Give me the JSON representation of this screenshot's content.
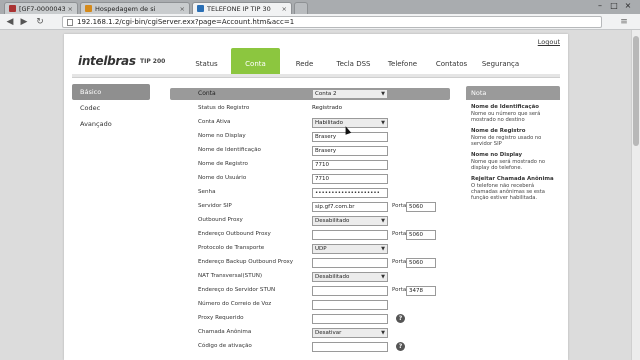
{
  "browser": {
    "tabs": [
      {
        "label": "[GF7-0000043807] R",
        "color": "#a33"
      },
      {
        "label": "Hospedagem de si",
        "color": "#d58a1a"
      },
      {
        "label": "TELEFONE IP TIP 30",
        "color": "#2a6fb5"
      }
    ],
    "close_glyph": "×",
    "url": "192.168.1.2/cgi-bin/cgiServer.exx?page=Account.htm&acc=1",
    "window_controls": [
      "–",
      "□",
      "×"
    ]
  },
  "header": {
    "logout": "Logout",
    "logo": "intelbras",
    "model": "TIP 200"
  },
  "nav": {
    "items": [
      "Status",
      "Conta",
      "Rede",
      "Tecla DSS",
      "Telefone",
      "Contatos",
      "Segurança"
    ],
    "active_index": 1
  },
  "sidebar": {
    "items": [
      "Básico",
      "Codec",
      "Avançado"
    ],
    "active_index": 0
  },
  "form": {
    "conta": {
      "label": "Conta",
      "value": "Conta 2"
    },
    "status_registro": {
      "label": "Status do Registro",
      "value": "Registrado"
    },
    "conta_ativa": {
      "label": "Conta Ativa",
      "value": "Habilitado"
    },
    "nome_display": {
      "label": "Nome no Display",
      "value": "Brasery"
    },
    "nome_identificacao": {
      "label": "Nome de Identificação",
      "value": "Brasery"
    },
    "nome_registro": {
      "label": "Nome de Registro",
      "value": "7710"
    },
    "nome_usuario": {
      "label": "Nome do Usuário",
      "value": "7710"
    },
    "senha": {
      "label": "Senha",
      "value": "••••••••••••••••••••"
    },
    "servidor_sip": {
      "label": "Servidor SIP",
      "value": "sip.gf7.com.br",
      "port_label": "Porta",
      "port": "5060"
    },
    "outbound_proxy": {
      "label": "Outbound Proxy",
      "value": "Desabilitado"
    },
    "endereco_outbound": {
      "label": "Endereço Outbound Proxy",
      "value": "",
      "port_label": "Porta",
      "port": "5060"
    },
    "protocolo_transporte": {
      "label": "Protocolo de Transporte",
      "value": "UDP"
    },
    "endereco_backup": {
      "label": "Endereço Backup Outbound Proxy",
      "value": "",
      "port_label": "Porta",
      "port": "5060"
    },
    "nat_transversal": {
      "label": "NAT Transversal(STUN)",
      "value": "Desabilitado"
    },
    "endereco_stun": {
      "label": "Endereço do Servidor STUN",
      "value": "",
      "port_label": "Porta",
      "port": "3478"
    },
    "numero_correio": {
      "label": "Número do Correio de Voz",
      "value": ""
    },
    "proxy_requerido": {
      "label": "Proxy Requerido",
      "value": ""
    },
    "chamada_anonima": {
      "label": "Chamada Anônima",
      "value": "Desativar"
    },
    "codigo_ativacao": {
      "label": "Código de ativação",
      "value": ""
    }
  },
  "help_glyph": "?",
  "caret_glyph": "▼",
  "note": {
    "title": "Nota",
    "items": [
      {
        "title": "Nome de Identificação",
        "text": "Nome ou número que será mostrado no destino"
      },
      {
        "title": "Nome de Registro",
        "text": "Nome de registro usado no servidor SIP"
      },
      {
        "title": "Nome no Display",
        "text": "Nome que será mostrado no display do telefone."
      },
      {
        "title": "Rejeitar Chamada Anônima",
        "text": "O telefone não receberá chamadas anônimas se esta função estiver habilitada."
      }
    ]
  },
  "colors": {
    "accent": "#8cc63f",
    "header_bar": "#9a9a9a"
  }
}
